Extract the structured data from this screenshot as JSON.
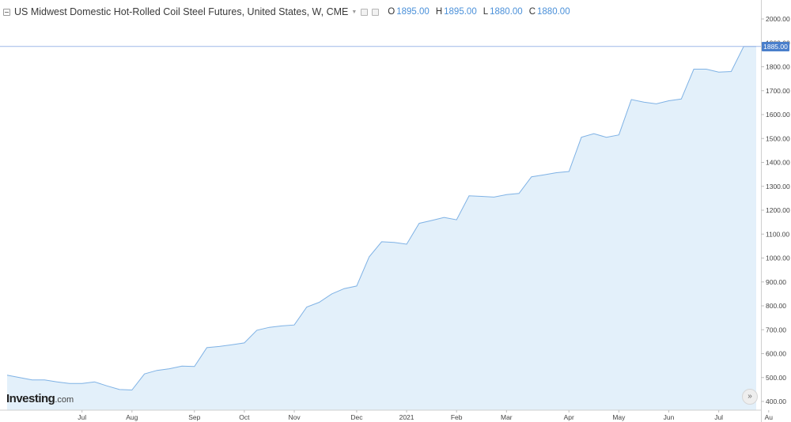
{
  "header": {
    "title": "US Midwest Domestic Hot-Rolled Coil Steel Futures, United States, W, CME",
    "ohlc": [
      {
        "key": "O",
        "value": "1895.00"
      },
      {
        "key": "H",
        "value": "1895.00"
      },
      {
        "key": "L",
        "value": "1880.00"
      },
      {
        "key": "C",
        "value": "1880.00"
      }
    ]
  },
  "logo": {
    "brand": "Investing",
    "suffix": ".com"
  },
  "price_tag": "1885.00",
  "colors": {
    "line": "#7fb2e5",
    "fill": "#e3f0fa",
    "accent": "#4a7fcb",
    "crosshair": "#9db8e8"
  },
  "icons": {
    "collapse": "minus-box-icon",
    "dropdown": "chevron-down-icon",
    "scroll": "double-chevron-right-icon"
  },
  "chart_data": {
    "type": "area",
    "title": "US Midwest Domestic Hot-Rolled Coil Steel Futures, United States, W, CME",
    "ylim": [
      350,
      2050
    ],
    "yticks": [
      "2000.00",
      "1900.00",
      "1800.00",
      "1700.00",
      "1600.00",
      "1500.00",
      "1400.00",
      "1300.00",
      "1200.00",
      "1100.00",
      "1000.00",
      "900.00",
      "800.00",
      "700.00",
      "600.00",
      "500.00",
      "400.00"
    ],
    "xticks": [
      {
        "label": "Jul",
        "week": 6
      },
      {
        "label": "Aug",
        "week": 10
      },
      {
        "label": "Sep",
        "week": 15
      },
      {
        "label": "Oct",
        "week": 19
      },
      {
        "label": "Nov",
        "week": 23
      },
      {
        "label": "Dec",
        "week": 28
      },
      {
        "label": "2021",
        "week": 32
      },
      {
        "label": "Feb",
        "week": 36
      },
      {
        "label": "Mar",
        "week": 40
      },
      {
        "label": "Apr",
        "week": 45
      },
      {
        "label": "May",
        "week": 49
      },
      {
        "label": "Jun",
        "week": 53
      },
      {
        "label": "Jul",
        "week": 57
      },
      {
        "label": "Au",
        "week": 61
      }
    ],
    "last_value": 1885,
    "grid": false,
    "series": [
      {
        "values": [
          510,
          500,
          490,
          490,
          482,
          475,
          475,
          482,
          465,
          450,
          448,
          515,
          530,
          537,
          548,
          546,
          625,
          630,
          637,
          645,
          698,
          710,
          716,
          720,
          795,
          815,
          850,
          872,
          883,
          1005,
          1068,
          1065,
          1058,
          1145,
          1157,
          1170,
          1160,
          1260,
          1258,
          1255,
          1265,
          1270,
          1340,
          1348,
          1357,
          1362,
          1505,
          1520,
          1505,
          1515,
          1663,
          1652,
          1645,
          1658,
          1665,
          1790,
          1790,
          1778,
          1780,
          1885,
          1885
        ]
      }
    ]
  }
}
